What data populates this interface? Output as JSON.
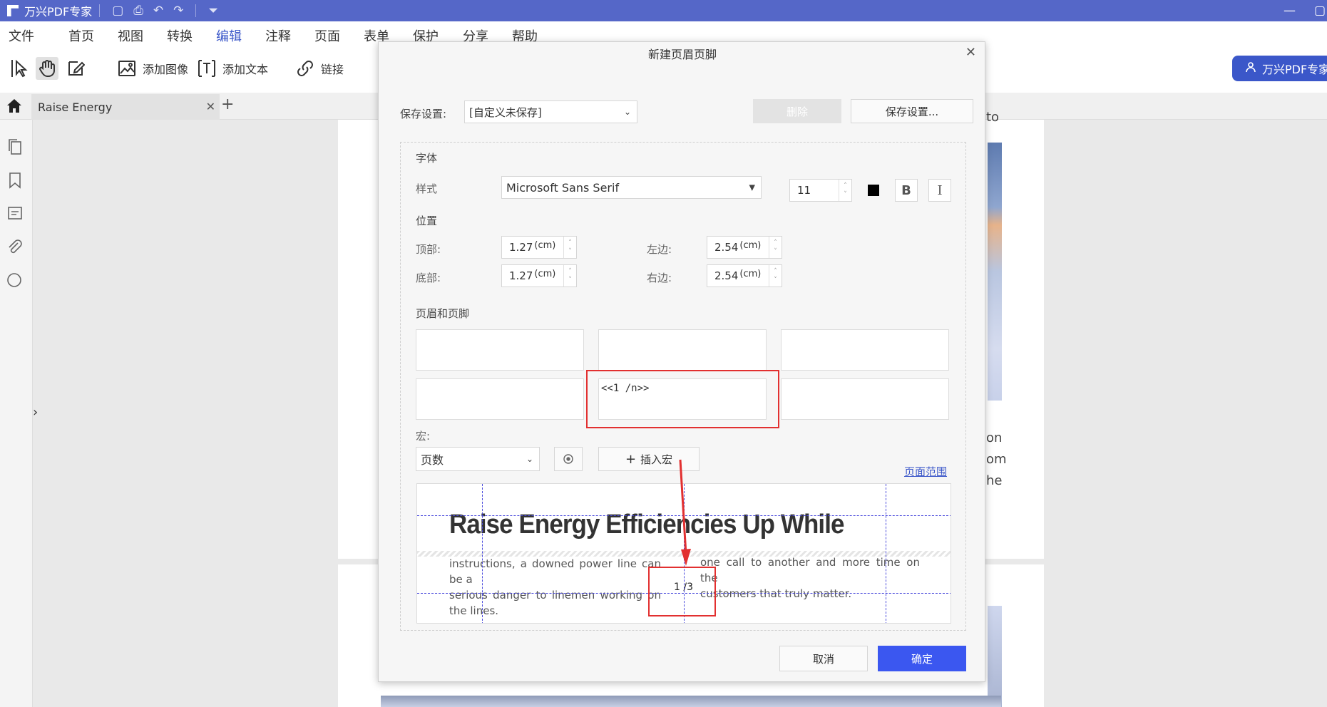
{
  "app": {
    "title": "万兴PDF专家"
  },
  "menu": {
    "items": [
      "文件",
      "首页",
      "视图",
      "转换",
      "编辑",
      "注释",
      "页面",
      "表单",
      "保护",
      "分享",
      "帮助"
    ],
    "active": "编辑"
  },
  "toolbar": {
    "add_image": "添加图像",
    "add_text": "添加文本",
    "link": "链接",
    "user_label": "万兴PDF专家"
  },
  "tabs": {
    "doc_tab": "Raise Energy"
  },
  "page_fragments": [
    "to",
    "on",
    "om",
    "he"
  ],
  "dialog": {
    "title": "新建页眉页脚",
    "save_settings_label": "保存设置:",
    "save_settings_value": "[自定义未保存]",
    "delete_label": "删除",
    "save_settings_button": "保存设置...",
    "font_section": "字体",
    "style_label": "样式",
    "font_value": "Microsoft Sans Serif",
    "font_size": "11",
    "font_color": "#000000",
    "bold_label": "B",
    "italic_label": "I",
    "position_section": "位置",
    "top_label": "顶部:",
    "top_value": "1.27",
    "bottom_label": "底部:",
    "bottom_value": "1.27",
    "left_label": "左边:",
    "left_value": "2.54",
    "right_label": "右边:",
    "right_value": "2.54",
    "unit": "(cm)",
    "hf_section": "页眉和页脚",
    "footer_center_value": "<<1 /n>>",
    "macro_label": "宏:",
    "macro_value": "页数",
    "insert_macro": "插入宏",
    "page_range": "页面范围",
    "cancel": "取消",
    "ok": "确定"
  },
  "preview": {
    "heading": "Raise Energy Efficiencies Up While",
    "left_text_line1": "instructions, a downed power line can be a",
    "left_text_line2": "serious danger to linemen working on the lines.",
    "right_text_line1": "one call to another and more time on the",
    "right_text_line2": "customers that truly matter.",
    "page_number": "1 /3"
  },
  "colors": {
    "titlebar": "#5567c8",
    "accent": "#3b57c9",
    "primary_button": "#3b57f0",
    "highlight": "#e23030"
  }
}
